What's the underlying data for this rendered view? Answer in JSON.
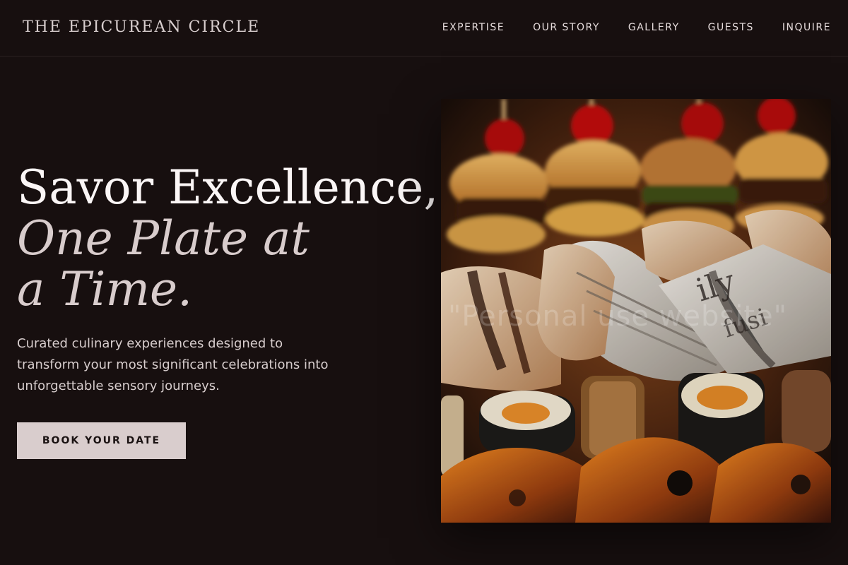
{
  "brand": {
    "name": "THE EPICUREAN CIRCLE"
  },
  "nav": {
    "items": [
      {
        "label": "EXPERTISE"
      },
      {
        "label": "OUR STORY"
      },
      {
        "label": "GALLERY"
      },
      {
        "label": "GUESTS"
      },
      {
        "label": "INQUIRE"
      }
    ]
  },
  "hero": {
    "headline_line1": "Savor Excellence,",
    "headline_italic": "One Plate at a Time.",
    "description": "Curated culinary experiences designed to transform your most significant celebrations into unforgettable sensory journeys.",
    "cta_label": "BOOK YOUR DATE",
    "image": {
      "alt": "Catering platter with mini burgers, wraps in newspaper and sushi rolls",
      "watermark_text": "\"Personal use website\""
    }
  },
  "colors": {
    "background": "#170f0f",
    "cta_background": "#d9cdcd",
    "headline_italic": "#d8cccc",
    "body_text": "#d7cdcd"
  },
  "icons": {
    "image_icon": "food-photo-icon"
  }
}
